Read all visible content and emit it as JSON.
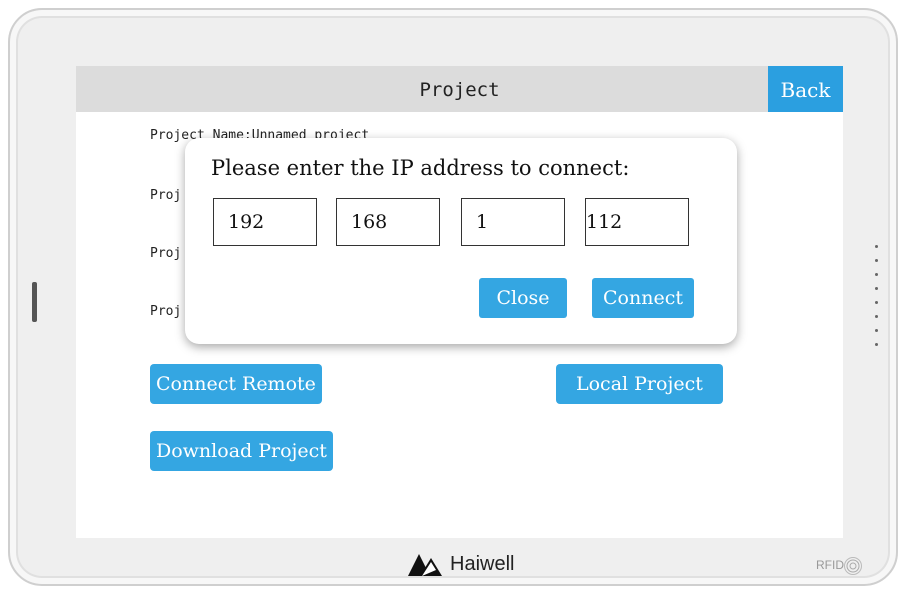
{
  "screen": {
    "title": "Project",
    "back_label": "Back",
    "project_name_line": "Project Name:Unnamed project",
    "project_lines": [
      "Proj",
      "Proj",
      "Proj"
    ],
    "buttons": {
      "connect_remote": "Connect Remote",
      "local_project": "Local Project",
      "download_project": "Download Project"
    }
  },
  "dialog": {
    "prompt": "Please enter the IP address to connect:",
    "ip": [
      "192",
      "168",
      "1",
      "112"
    ],
    "close_label": "Close",
    "connect_label": "Connect"
  },
  "device": {
    "brand": "Haiwell",
    "rfid_label": "RFID"
  },
  "colors": {
    "accent": "#34a6e2",
    "titlebar": "#dcdcdc"
  }
}
